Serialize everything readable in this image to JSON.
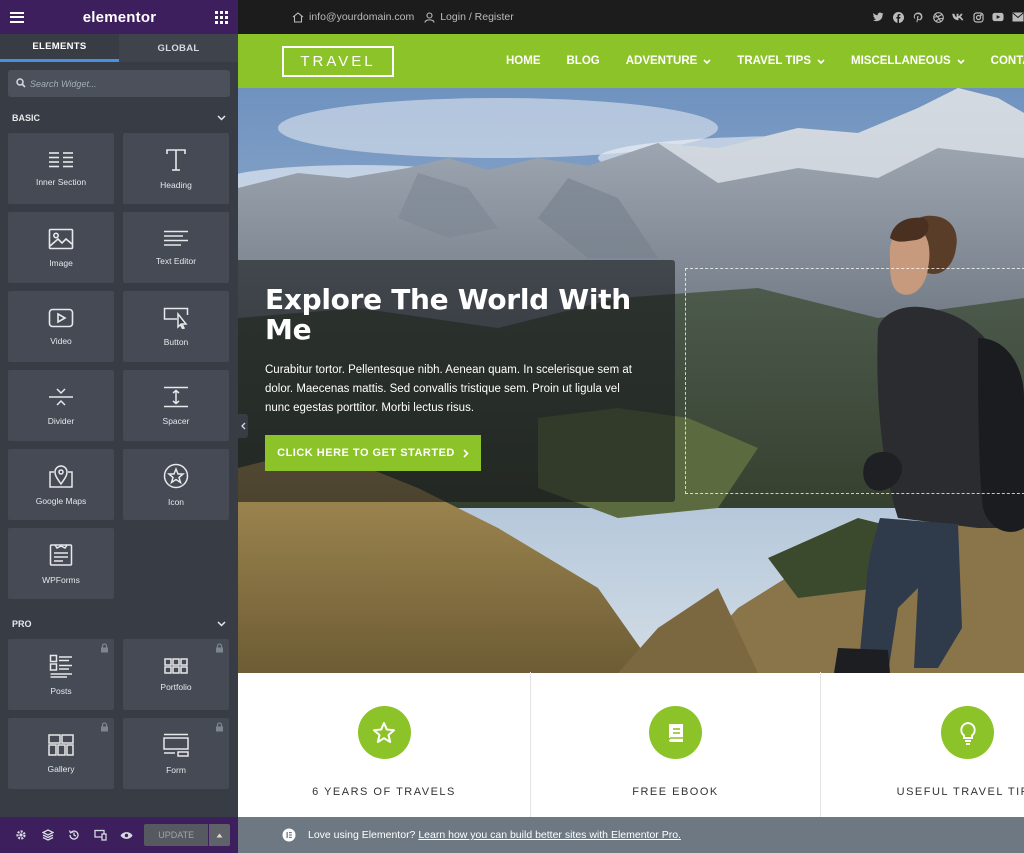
{
  "panel": {
    "logo": "elementor",
    "tabs": [
      {
        "label": "ELEMENTS",
        "active": true
      },
      {
        "label": "GLOBAL",
        "active": false
      }
    ],
    "search_placeholder": "Search Widget...",
    "categories": [
      {
        "label": "BASIC",
        "widgets": [
          {
            "label": "Inner Section",
            "icon": "columns-icon"
          },
          {
            "label": "Heading",
            "icon": "heading-icon"
          },
          {
            "label": "Image",
            "icon": "image-icon"
          },
          {
            "label": "Text Editor",
            "icon": "text-align-icon"
          },
          {
            "label": "Video",
            "icon": "video-play-icon"
          },
          {
            "label": "Button",
            "icon": "cursor-button-icon"
          },
          {
            "label": "Divider",
            "icon": "divider-icon"
          },
          {
            "label": "Spacer",
            "icon": "spacer-icon"
          },
          {
            "label": "Google Maps",
            "icon": "map-icon"
          },
          {
            "label": "Icon",
            "icon": "star-circle-icon"
          },
          {
            "label": "WPForms",
            "icon": "form-icon"
          }
        ]
      },
      {
        "label": "PRO",
        "widgets": [
          {
            "label": "Posts",
            "icon": "posts-list-icon",
            "locked": true
          },
          {
            "label": "Portfolio",
            "icon": "portfolio-grid-icon",
            "locked": true
          },
          {
            "label": "Gallery",
            "icon": "gallery-grid-icon",
            "locked": true
          },
          {
            "label": "Form",
            "icon": "form-layout-icon",
            "locked": true
          }
        ]
      }
    ],
    "footer": {
      "update_label": "UPDATE",
      "icons": [
        "settings-gear-icon",
        "layers-icon",
        "history-icon",
        "responsive-icon",
        "preview-eye-icon"
      ]
    }
  },
  "site": {
    "topbar": {
      "email": "info@yourdomain.com",
      "login": "Login / Register",
      "social_icons": [
        "twitter-icon",
        "facebook-icon",
        "pinterest-icon",
        "dribbble-icon",
        "vk-icon",
        "instagram-icon",
        "youtube-icon",
        "email-icon"
      ]
    },
    "logo": "TRAVEL",
    "menu": [
      {
        "label": "HOME",
        "dropdown": false
      },
      {
        "label": "BLOG",
        "dropdown": false
      },
      {
        "label": "ADVENTURE",
        "dropdown": true
      },
      {
        "label": "TRAVEL TIPS",
        "dropdown": true
      },
      {
        "label": "MISCELLANEOUS",
        "dropdown": true
      },
      {
        "label": "CONTACT",
        "dropdown": false
      }
    ],
    "hero": {
      "title": "Explore The World With Me",
      "text": "Curabitur tortor. Pellentesque nibh. Aenean quam. In scelerisque sem at dolor. Maecenas mattis. Sed convallis tristique sem. Proin ut ligula vel nunc egestas porttitor. Morbi lectus risus.",
      "button": "CLICK HERE TO GET STARTED"
    },
    "features": [
      {
        "title": "6 YEARS OF TRAVELS",
        "icon": "star-icon"
      },
      {
        "title": "FREE EBOOK",
        "icon": "book-icon"
      },
      {
        "title": "USEFUL TRAVEL TIPS",
        "icon": "lightbulb-icon"
      }
    ],
    "promo": {
      "text": "Love using Elementor?",
      "link": "Learn how you can build better sites with Elementor Pro."
    }
  },
  "colors": {
    "panel_bg": "#383c45",
    "panel_header": "#3c1f5c",
    "accent_green": "#8cc328",
    "topbar": "#1c1c1c",
    "promo_bar": "#6d7882"
  }
}
